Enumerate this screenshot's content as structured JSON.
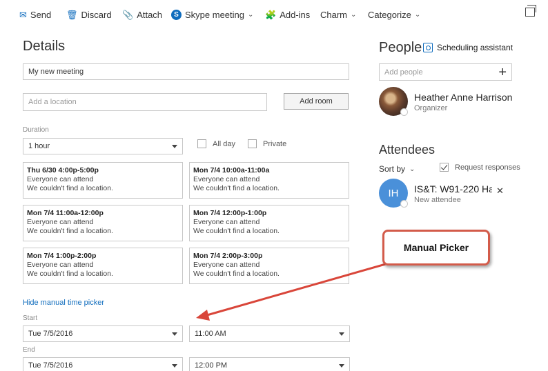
{
  "toolbar": {
    "send": "Send",
    "discard": "Discard",
    "attach": "Attach",
    "skype": "Skype meeting",
    "addins": "Add-ins",
    "charm": "Charm",
    "categorize": "Categorize"
  },
  "details": {
    "heading": "Details",
    "title_value": "My new meeting",
    "location_placeholder": "Add a location",
    "add_room": "Add room",
    "duration_label": "Duration",
    "duration_value": "1 hour",
    "all_day": "All day",
    "private": "Private",
    "slots": [
      {
        "time": "Thu 6/30 4:00p-5:00p",
        "attend": "Everyone can attend",
        "loc": "We couldn't find a location."
      },
      {
        "time": "Mon 7/4 10:00a-11:00a",
        "attend": "Everyone can attend",
        "loc": "We couldn't find a location."
      },
      {
        "time": "Mon 7/4 11:00a-12:00p",
        "attend": "Everyone can attend",
        "loc": "We couldn't find a location."
      },
      {
        "time": "Mon 7/4 12:00p-1:00p",
        "attend": "Everyone can attend",
        "loc": "We couldn't find a location."
      },
      {
        "time": "Mon 7/4 1:00p-2:00p",
        "attend": "Everyone can attend",
        "loc": "We couldn't find a location."
      },
      {
        "time": "Mon 7/4 2:00p-3:00p",
        "attend": "Everyone can attend",
        "loc": "We couldn't find a location."
      }
    ],
    "hide_picker": "Hide manual time picker",
    "start_label": "Start",
    "start_date": "Tue 7/5/2016",
    "start_time": "11:00 AM",
    "end_label": "End",
    "end_date": "Tue 7/5/2016",
    "end_time": "12:00 PM"
  },
  "people": {
    "heading": "People",
    "scheduling": "Scheduling assistant",
    "add_placeholder": "Add people",
    "organizer_name": "Heather Anne Harrison",
    "organizer_role": "Organizer",
    "attendees_heading": "Attendees",
    "sort_by": "Sort by",
    "request_responses": "Request responses",
    "attendee_initials": "IH",
    "attendee_name": "IS&T: W91-220 Ha",
    "attendee_sub": "New attendee"
  },
  "callout": {
    "label": "Manual Picker"
  },
  "colors": {
    "accent": "#0f6cbd",
    "arrow": "#d9463a",
    "attendee_avatar": "#4a90d9"
  }
}
